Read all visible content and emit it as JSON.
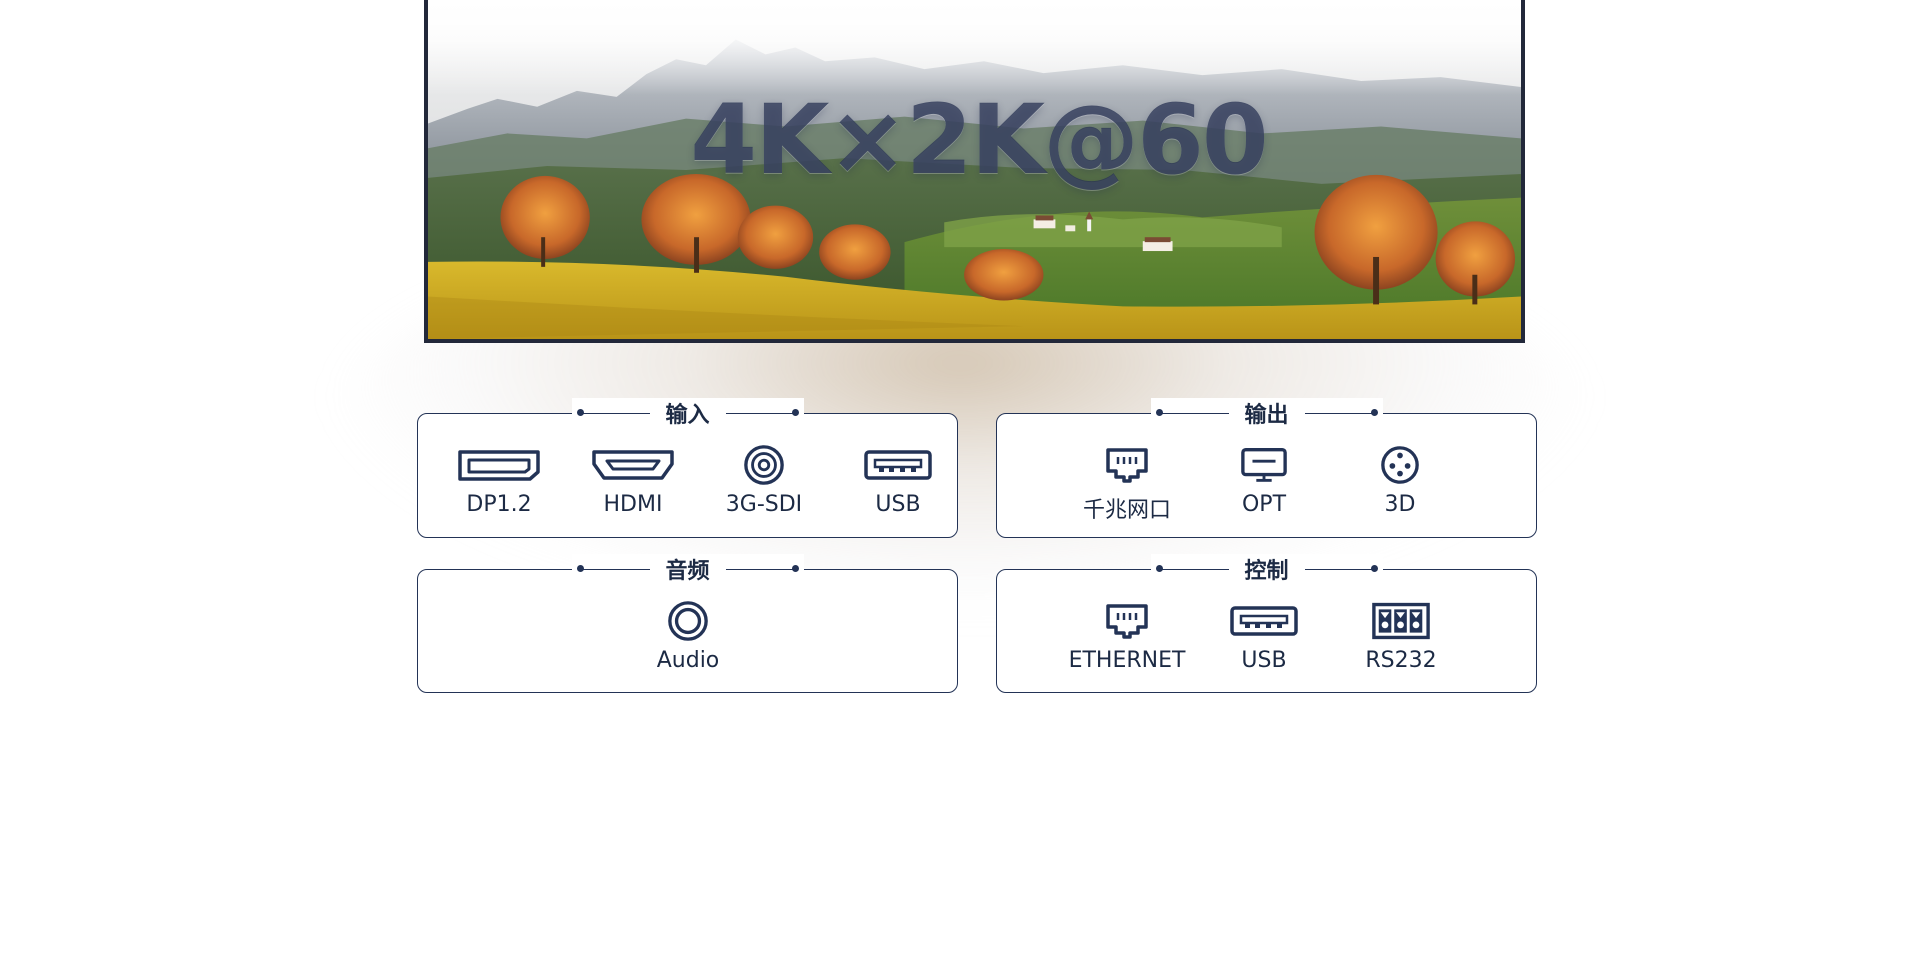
{
  "hero": {
    "headline": "4K×2K@60"
  },
  "panels": {
    "input": {
      "title": "输入",
      "ports": [
        {
          "label": "DP1.2",
          "icon": "displayport-icon"
        },
        {
          "label": "HDMI",
          "icon": "hdmi-icon"
        },
        {
          "label": "3G-SDI",
          "icon": "sdi-coax-icon"
        },
        {
          "label": "USB",
          "icon": "usb-icon"
        }
      ]
    },
    "output": {
      "title": "输出",
      "ports": [
        {
          "label": "千兆网口",
          "icon": "rj45-icon"
        },
        {
          "label": "OPT",
          "icon": "optical-icon"
        },
        {
          "label": "3D",
          "icon": "3d-connector-icon"
        }
      ]
    },
    "audio": {
      "title": "音频",
      "ports": [
        {
          "label": "Audio",
          "icon": "audio-jack-icon"
        }
      ]
    },
    "control": {
      "title": "控制",
      "ports": [
        {
          "label": "ETHERNET",
          "icon": "ethernet-icon"
        },
        {
          "label": "USB",
          "icon": "usb-icon"
        },
        {
          "label": "RS232",
          "icon": "rs232-terminal-icon"
        }
      ]
    }
  },
  "colors": {
    "ink": "#233356",
    "text": "#1c2a44",
    "background": "#ffffff"
  }
}
